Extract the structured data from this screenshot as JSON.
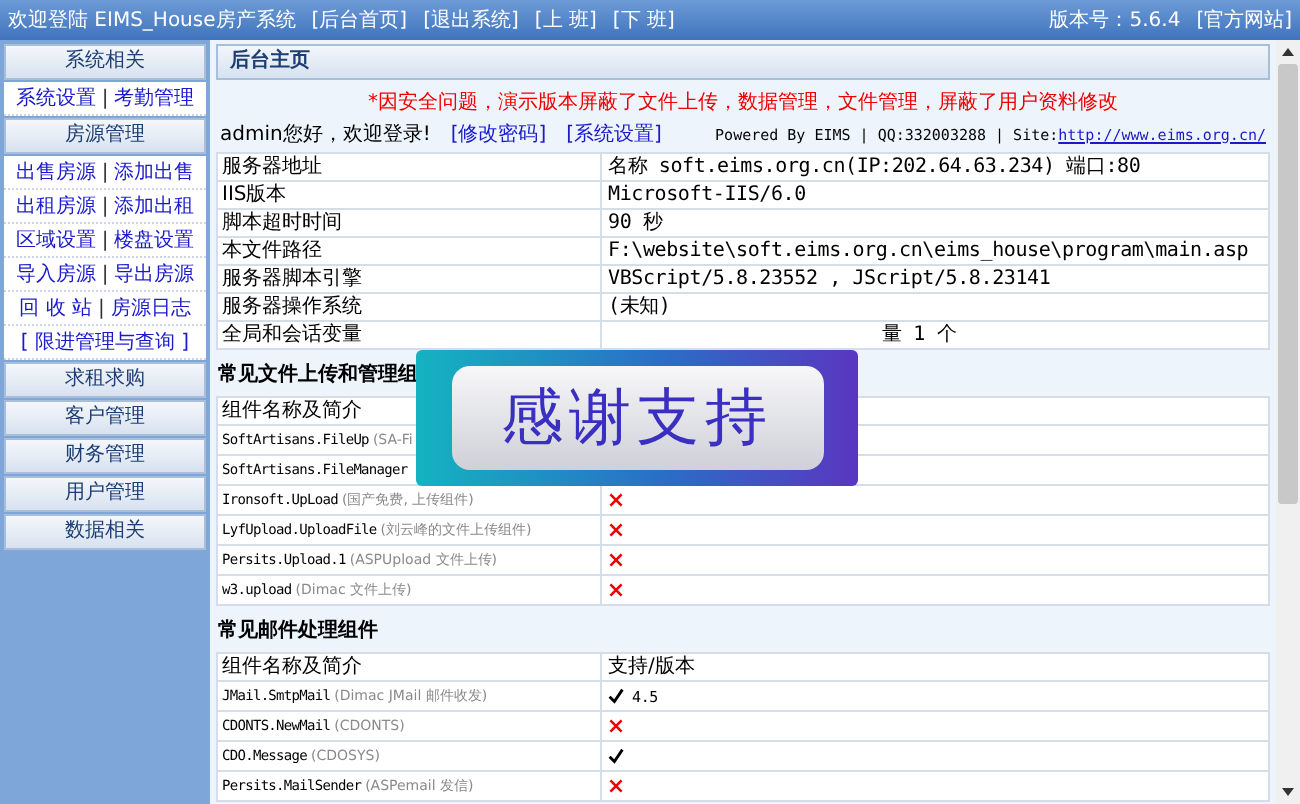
{
  "topbar": {
    "welcome": "欢迎登陆 EIMS_House房产系统",
    "links": [
      "[后台首页]",
      "[退出系统]",
      "[上 班]",
      "[下 班]"
    ],
    "version": "版本号：5.6.4",
    "site_link": "[官方网站]"
  },
  "sidebar": {
    "separator": "|",
    "sections": [
      {
        "title": "系统相关",
        "rows": [
          [
            "系统设置",
            "考勤管理"
          ]
        ]
      },
      {
        "title": "房源管理",
        "rows": [
          [
            "出售房源",
            "添加出售"
          ],
          [
            "出租房源",
            "添加出租"
          ],
          [
            "区域设置",
            "楼盘设置"
          ],
          [
            "导入房源",
            "导出房源"
          ],
          [
            "回 收 站",
            "房源日志"
          ],
          [
            "[ 限进管理与查询 ]"
          ]
        ]
      },
      {
        "title": "求租求购"
      },
      {
        "title": "客户管理"
      },
      {
        "title": "财务管理"
      },
      {
        "title": "用户管理"
      },
      {
        "title": "数据相关"
      }
    ]
  },
  "main": {
    "header": "后台主页",
    "notice": "*因安全问题，演示版本屏蔽了文件上传，数据管理，文件管理，屏蔽了用户资料修改",
    "greeting": "admin您好，欢迎登录!",
    "actions": [
      "[修改密码]",
      "[系统设置]"
    ],
    "powered": "Powered By EIMS | QQ:332003288 | Site:",
    "site_url": "http://www.eims.org.cn/",
    "server_rows": [
      {
        "label": "服务器地址",
        "value": "名称 soft.eims.org.cn(IP:202.64.63.234) 端口:80"
      },
      {
        "label": "IIS版本",
        "value": "Microsoft-IIS/6.0"
      },
      {
        "label": "脚本超时时间",
        "value": "90 秒"
      },
      {
        "label": "本文件路径",
        "value": "F:\\website\\soft.eims.org.cn\\eims_house\\program\\main.asp"
      },
      {
        "label": "服务器脚本引擎",
        "value": "VBScript/5.8.23552 , JScript/5.8.23141"
      },
      {
        "label": "服务器操作系统",
        "value": "(未知)"
      },
      {
        "label": "全局和会话变量",
        "value": "量 1 个"
      }
    ],
    "sections": [
      {
        "title": "常见文件上传和管理组",
        "columns": [
          "组件名称及简介"
        ],
        "rows": [
          {
            "name": "SoftArtisans.FileUp",
            "note": "(SA-Fi"
          },
          {
            "name": "SoftArtisans.FileManager"
          },
          {
            "name": "Ironsoft.UpLoad",
            "note": "(国产免费, 上传组件)",
            "supported": false
          },
          {
            "name": "LyfUpload.UploadFile",
            "note": "(刘云峰的文件上传组件)",
            "supported": false
          },
          {
            "name": "Persits.Upload.1",
            "note": "(ASPUpload 文件上传)",
            "supported": false
          },
          {
            "name": "w3.upload",
            "note": "(Dimac 文件上传)",
            "supported": false
          }
        ]
      },
      {
        "title": "常见邮件处理组件",
        "columns": [
          "组件名称及简介",
          "支持/版本"
        ],
        "rows": [
          {
            "name": "JMail.SmtpMail",
            "note": "(Dimac JMail 邮件收发)",
            "supported": true,
            "version": "4.5"
          },
          {
            "name": "CDONTS.NewMail",
            "note": "(CDONTS)",
            "supported": false
          },
          {
            "name": "CDO.Message",
            "note": "(CDOSYS)",
            "supported": true
          },
          {
            "name": "Persits.MailSender",
            "note": "(ASPemail 发信)",
            "supported": false
          }
        ]
      }
    ]
  },
  "overlay": {
    "text": "感谢支持"
  }
}
